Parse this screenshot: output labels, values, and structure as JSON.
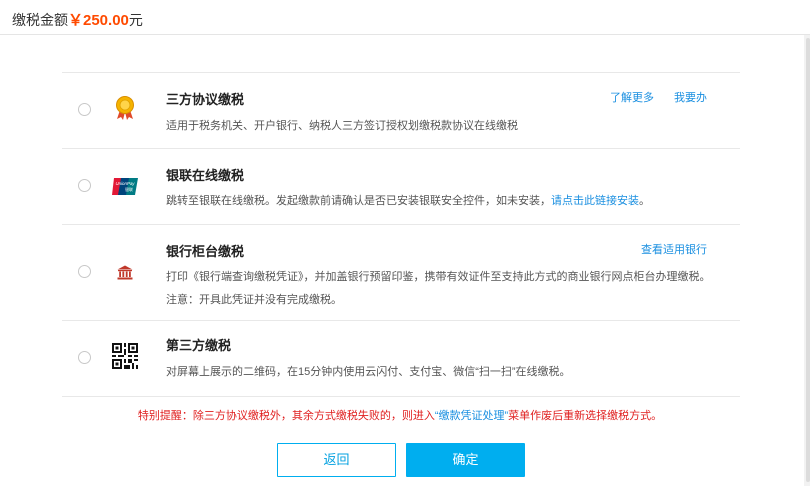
{
  "header": {
    "label": "缴税金额",
    "amount": "￥250.00",
    "unit": "元"
  },
  "options": [
    {
      "title": "三方协议缴税",
      "desc": "适用于税务机关、开户银行、纳税人三方签订授权划缴税款协议在线缴税",
      "icon": "medal-icon",
      "actions": [
        "了解更多",
        "我要办"
      ]
    },
    {
      "title": "银联在线缴税",
      "desc_before": "跳转至银联在线缴税。发起缴款前请确认是否已安装银联安全控件，如未安装，",
      "desc_link": "请点击此链接安装",
      "desc_after": "。",
      "icon": "unionpay-icon",
      "icon_text_top": "UnionPay",
      "icon_text_bottom": "银联"
    },
    {
      "title": "银行柜台缴税",
      "desc": "打印《银行端查询缴税凭证》，并加盖银行预留印鉴，携带有效证件至支持此方式的商业银行网点柜台办理缴税。",
      "note": "注意：开具此凭证并没有完成缴税。",
      "icon": "bank-icon",
      "actions": [
        "查看适用银行"
      ]
    },
    {
      "title": "第三方缴税",
      "desc": "对屏幕上展示的二维码，在15分钟内使用云闪付、支付宝、微信“扫一扫”在线缴税。",
      "icon": "qrcode-icon"
    }
  ],
  "reminder": {
    "before": "特别提醒：除三方协议缴税外，其余方式缴税失败的，则进入",
    "highlight": "“缴款凭证处理”",
    "after": "菜单作废后重新选择缴税方式。"
  },
  "buttons": {
    "back": "返回",
    "confirm": "确定"
  },
  "colors": {
    "accent": "#00aeef",
    "amount": "#ff4a00",
    "warning": "#e02020",
    "link": "#1a8fe0"
  }
}
